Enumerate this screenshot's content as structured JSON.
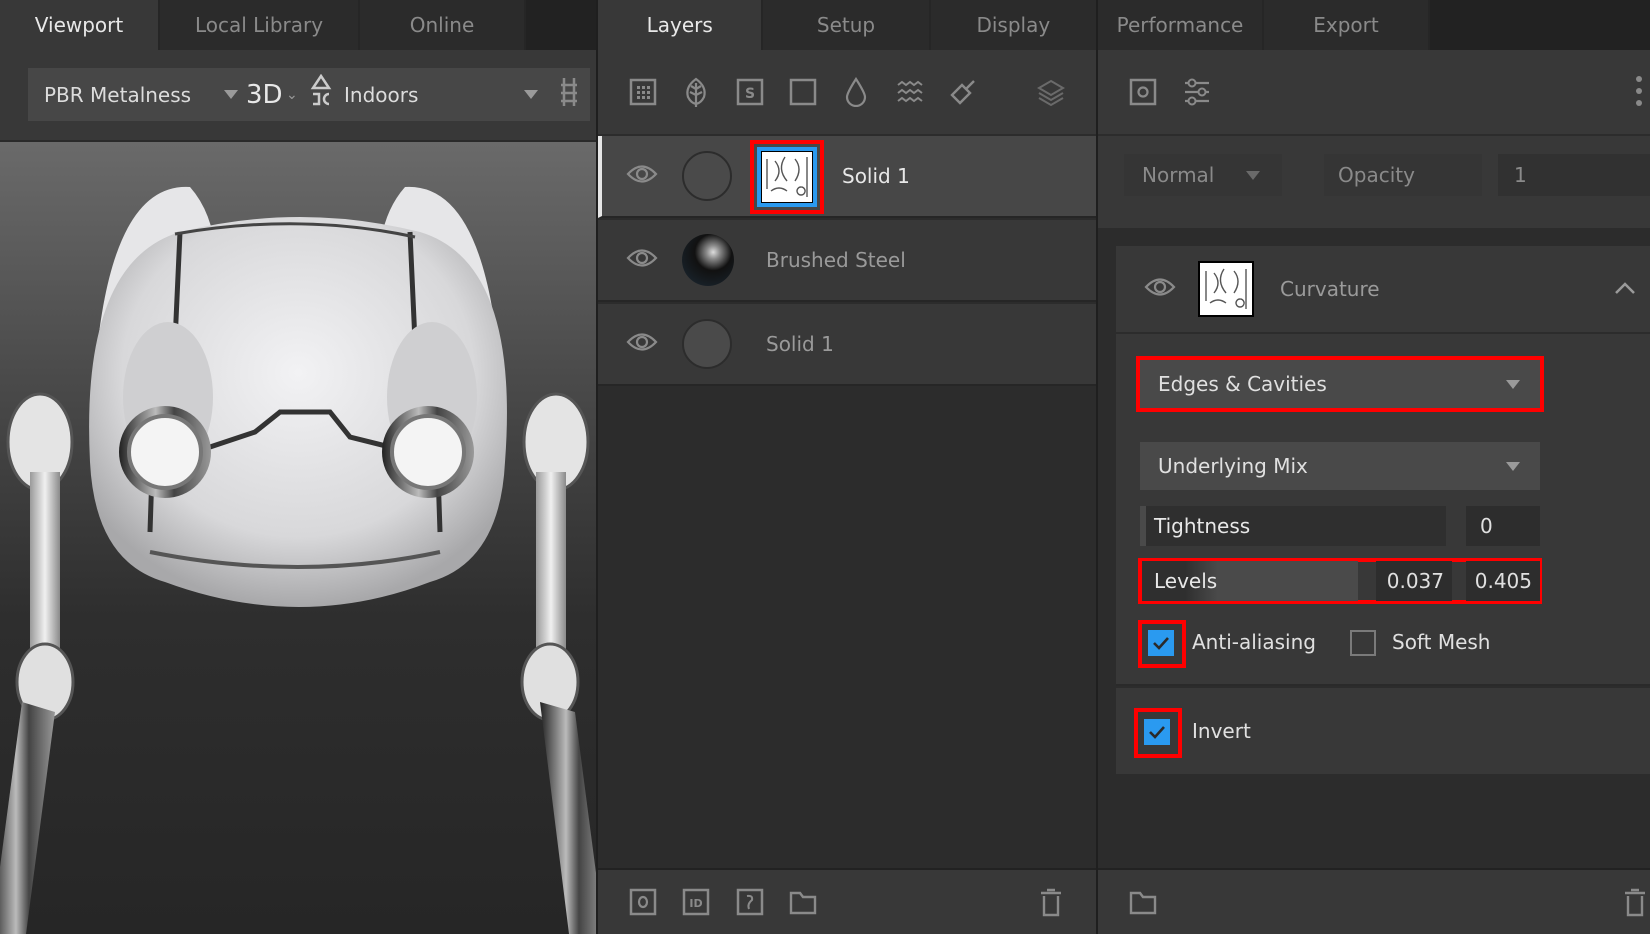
{
  "left_panel": {
    "tabs": [
      {
        "label": "Viewport",
        "active": true
      },
      {
        "label": "Local Library",
        "active": false
      },
      {
        "label": "Online",
        "active": false
      }
    ],
    "toolbar": {
      "shader": "PBR Metalness",
      "view_mode": "3D",
      "environment": "Indoors",
      "icons": [
        "lighting-icon",
        "grid-icon"
      ]
    }
  },
  "middle_panel": {
    "tabs": [
      {
        "label": "Layers",
        "active": true
      },
      {
        "label": "Setup",
        "active": false
      },
      {
        "label": "Display",
        "active": false
      }
    ],
    "toolbar_icons": [
      "fill-layer-icon",
      "organic-leaf-icon",
      "smart-material-icon",
      "square-mask-icon",
      "drop-icon",
      "wave-icon",
      "brush-icon",
      "layers-stack-icon"
    ],
    "layers": [
      {
        "name": "Solid 1",
        "selected": true,
        "visible": true,
        "has_mask": true
      },
      {
        "name": "Brushed Steel",
        "selected": false,
        "visible": true,
        "has_mask": false
      },
      {
        "name": "Solid 1",
        "selected": false,
        "visible": true,
        "has_mask": false
      }
    ],
    "footer_icons": [
      "add-mask-icon",
      "id-mask-icon",
      "curvature-mask-icon",
      "folder-icon",
      "trash-icon"
    ]
  },
  "right_panel": {
    "tabs": [
      {
        "label": "Performance",
        "active": false
      },
      {
        "label": "Export",
        "active": false
      }
    ],
    "toolbar_icons": [
      "mask-icon",
      "sliders-icon",
      "more-vert-icon"
    ],
    "blend_mode": "Normal",
    "opacity_label": "Opacity",
    "opacity_value": "1",
    "generator": {
      "name": "Curvature",
      "mode": "Edges & Cavities",
      "mix": "Underlying Mix",
      "tightness_label": "Tightness",
      "tightness_value": "0",
      "levels_label": "Levels",
      "levels_low": "0.037",
      "levels_high": "0.405",
      "anti_aliasing_label": "Anti-aliasing",
      "anti_aliasing": true,
      "soft_mesh_label": "Soft Mesh",
      "soft_mesh": false,
      "invert_label": "Invert",
      "invert": true
    },
    "footer_icons": [
      "folder-icon",
      "trash-icon"
    ]
  },
  "colors": {
    "accent_blue": "#2a9af0",
    "highlight_red": "#ff0000"
  }
}
